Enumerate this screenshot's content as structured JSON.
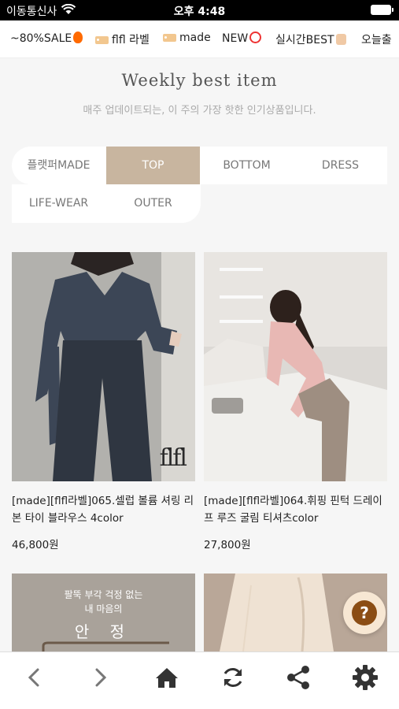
{
  "status_bar": {
    "carrier": "이동통신사",
    "time": "오후 4:48"
  },
  "category_nav": [
    {
      "label": "~80%SALE",
      "icon": "fire-icon"
    },
    {
      "label": "flfl 라벨",
      "icon": "tag-icon"
    },
    {
      "label": "made",
      "icon": "tag-icon"
    },
    {
      "label": "NEW",
      "icon": "alarm-clock-icon"
    },
    {
      "label": "실시간BEST",
      "icon": "thumbs-up-icon"
    },
    {
      "label": "오늘출",
      "icon": ""
    }
  ],
  "section": {
    "title": "Weekly best item",
    "subtitle": "매주 업데이트되는, 이 주의 가장 핫한 인기상품입니다."
  },
  "filter_tabs": [
    {
      "label": "플랫퍼MADE",
      "active": false
    },
    {
      "label": "TOP",
      "active": true
    },
    {
      "label": "BOTTOM",
      "active": false
    },
    {
      "label": "DRESS",
      "active": false
    },
    {
      "label": "LIFE-WEAR",
      "active": false
    },
    {
      "label": "OUTER",
      "active": false
    }
  ],
  "products": [
    {
      "name": "[made][flfl라벨]065.셀럽 볼륨 셔링 리본 타이 블라우스 4color",
      "price": "46,800원",
      "watermark": "flfl"
    },
    {
      "name": "[made][flfl라벨]064.휘핑 핀턱 드레이프 루즈 굴림 티셔츠color",
      "price": "27,800원"
    }
  ],
  "promo_card": {
    "line1": "팔뚝 부각 걱정 없는",
    "line2": "내 마음의",
    "line3": "안 정"
  },
  "help_button": {
    "label": "?"
  },
  "toolbar": [
    "back-icon",
    "forward-icon",
    "home-icon",
    "refresh-icon",
    "share-icon",
    "settings-icon"
  ],
  "colors": {
    "accent_tab": "#c8b59f",
    "help_bg": "#8b4d14"
  }
}
